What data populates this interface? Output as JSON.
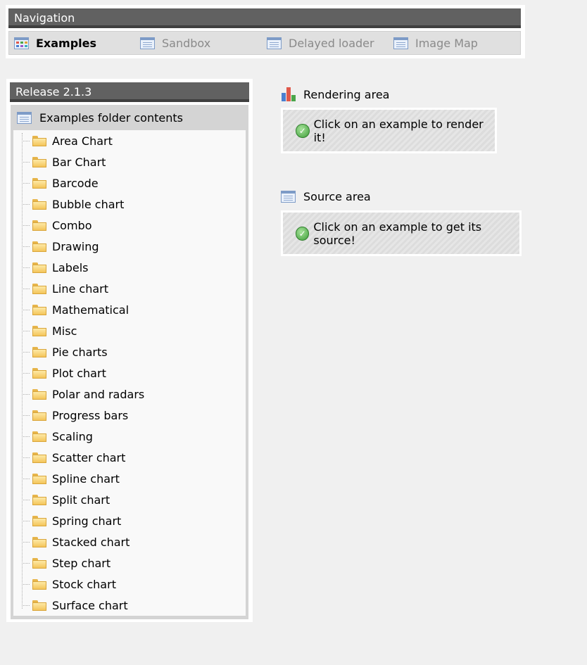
{
  "navigation": {
    "header": "Navigation",
    "tabs": [
      {
        "label": "Examples",
        "icon": "grid-list-icon",
        "active": true
      },
      {
        "label": "Sandbox",
        "icon": "list-icon",
        "active": false
      },
      {
        "label": "Delayed loader",
        "icon": "list-icon",
        "active": false
      },
      {
        "label": "Image Map",
        "icon": "list-icon",
        "active": false
      }
    ]
  },
  "release": {
    "header": "Release 2.1.3",
    "root_label": "Examples folder contents",
    "folders": [
      "Area Chart",
      "Bar Chart",
      "Barcode",
      "Bubble chart",
      "Combo",
      "Drawing",
      "Labels",
      "Line chart",
      "Mathematical",
      "Misc",
      "Pie charts",
      "Plot chart",
      "Polar and radars",
      "Progress bars",
      "Scaling",
      "Scatter chart",
      "Spline chart",
      "Split chart",
      "Spring chart",
      "Stacked chart",
      "Step chart",
      "Stock chart",
      "Surface chart"
    ]
  },
  "rendering": {
    "title": "Rendering area",
    "message": "Click on an example to render it!"
  },
  "source": {
    "title": "Source area",
    "message": "Click on an example to get its source!"
  },
  "colors": {
    "header_bg": "#616161",
    "header_border": "#3f3f3f",
    "page_bg": "#f0f0f0",
    "ok_green": "#3f9e3a"
  }
}
